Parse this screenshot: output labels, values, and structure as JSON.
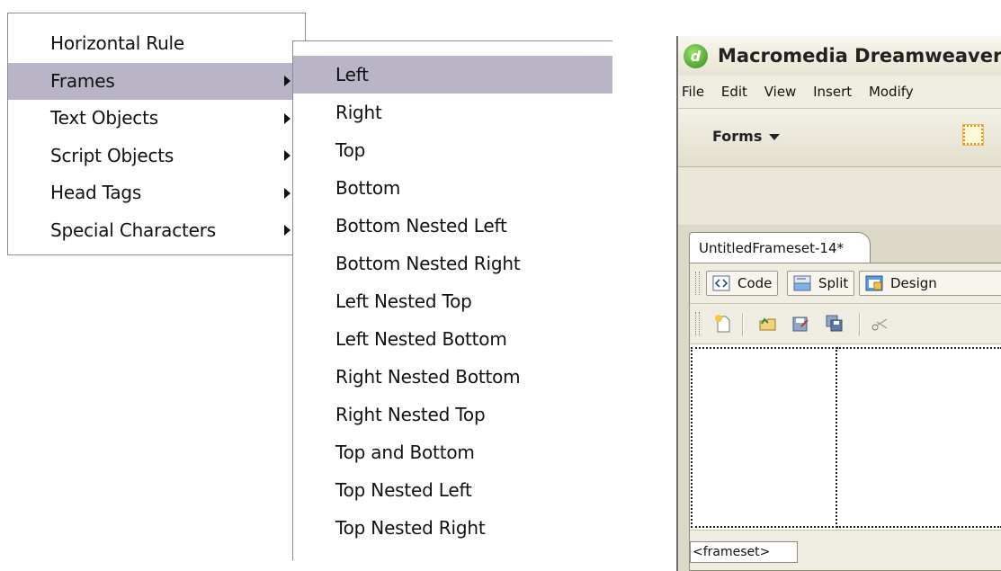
{
  "insert_menu": {
    "items": [
      {
        "label": "Horizontal Rule",
        "has_submenu": false,
        "highlighted": false
      },
      {
        "label": "Frames",
        "has_submenu": true,
        "highlighted": true
      },
      {
        "label": "Text Objects",
        "has_submenu": true,
        "highlighted": false
      },
      {
        "label": "Script Objects",
        "has_submenu": true,
        "highlighted": false
      },
      {
        "label": "Head Tags",
        "has_submenu": true,
        "highlighted": false
      },
      {
        "label": "Special Characters",
        "has_submenu": true,
        "highlighted": false
      }
    ]
  },
  "frames_submenu": {
    "items": [
      {
        "label": "Left",
        "highlighted": true
      },
      {
        "label": "Right",
        "highlighted": false
      },
      {
        "label": "Top",
        "highlighted": false
      },
      {
        "label": "Bottom",
        "highlighted": false
      },
      {
        "label": "Bottom Nested Left",
        "highlighted": false
      },
      {
        "label": "Bottom Nested Right",
        "highlighted": false
      },
      {
        "label": "Left Nested Top",
        "highlighted": false
      },
      {
        "label": "Left Nested Bottom",
        "highlighted": false
      },
      {
        "label": "Right Nested Bottom",
        "highlighted": false
      },
      {
        "label": "Right Nested Top",
        "highlighted": false
      },
      {
        "label": "Top and Bottom",
        "highlighted": false
      },
      {
        "label": "Top Nested Left",
        "highlighted": false
      },
      {
        "label": "Top Nested Right",
        "highlighted": false
      }
    ]
  },
  "dreamweaver": {
    "title": "Macromedia Dreamweaver",
    "menubar": [
      "File",
      "Edit",
      "View",
      "Insert",
      "Modify"
    ],
    "insert_category": "Forms",
    "document_tab": "UntitledFrameset-14*",
    "view_buttons": [
      "Code",
      "Split",
      "Design"
    ],
    "tag_selector": "<frameset>",
    "icons": [
      "form-icon",
      "new-document-icon",
      "open-folder-icon",
      "save-icon",
      "save-all-icon",
      "cut-icon"
    ]
  },
  "colors": {
    "menu_highlight": "#b9b4c6",
    "menu_border": "#8c8c8c",
    "window_chrome": "#ece9d8"
  }
}
